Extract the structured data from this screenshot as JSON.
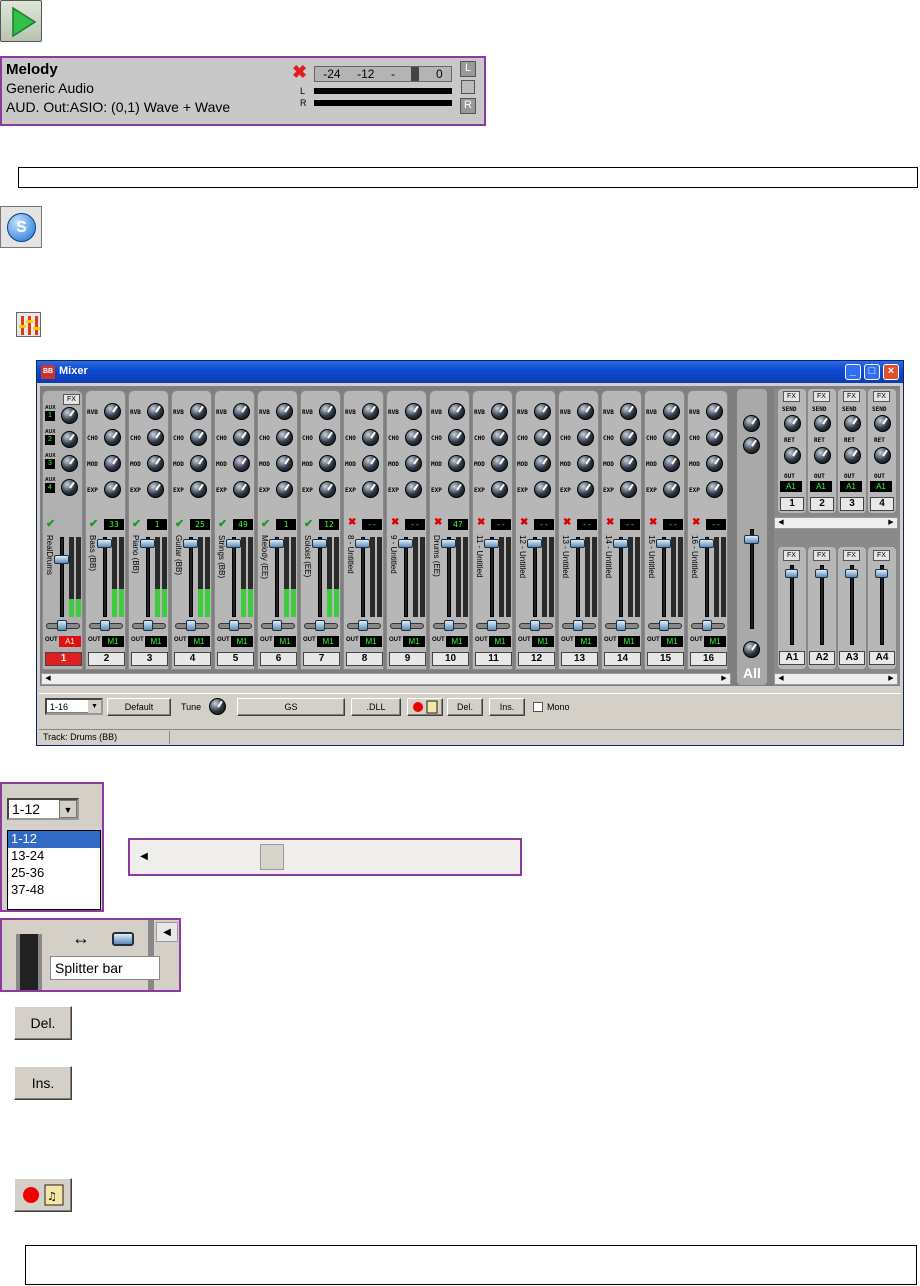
{
  "transport": {
    "play_icon": "play-icon"
  },
  "track_header": {
    "name": "Melody",
    "device": "Generic Audio",
    "output": "AUD. Out:ASIO: (0,1) Wave + Wave",
    "meter_scale": [
      "-24",
      "-12",
      "-",
      "0"
    ],
    "left_label": "L",
    "right_label": "R",
    "l_button": "L",
    "r_button": "R"
  },
  "solo_icon": "solo-icon",
  "mixer_icon": "mixer-icon",
  "mixer": {
    "title": "Mixer",
    "knob_labels": [
      "RVB",
      "CHO",
      "MOD",
      "EXP"
    ],
    "fx_label": "FX",
    "out_label": "OUT",
    "aux_labels": [
      "AUX",
      "AUX",
      "AUX",
      "AUX"
    ],
    "aux_values": [
      "1",
      "2",
      "3",
      "4"
    ],
    "strips": [
      {
        "name": "RealDrums",
        "vol": "",
        "num": "1",
        "out": "A1",
        "on": true,
        "active": true
      },
      {
        "name": "Bass  (BB)",
        "vol": "33",
        "num": "2",
        "out": "M1",
        "on": true
      },
      {
        "name": "Piano  (BB)",
        "vol": "1",
        "num": "3",
        "out": "M1",
        "on": true
      },
      {
        "name": "Guitar (BB)",
        "vol": "25",
        "num": "4",
        "out": "M1",
        "on": true
      },
      {
        "name": "Strings (BB)",
        "vol": "49",
        "num": "5",
        "out": "M1",
        "on": true
      },
      {
        "name": "Melody  (EE)",
        "vol": "1",
        "num": "6",
        "out": "M1",
        "on": true
      },
      {
        "name": "Soloist (EE)",
        "vol": "12",
        "num": "7",
        "out": "M1",
        "on": true
      },
      {
        "name": "8 - Untitled",
        "vol": "--",
        "num": "8",
        "out": "M1",
        "on": false
      },
      {
        "name": "9 - Untitled",
        "vol": "--",
        "num": "9",
        "out": "M1",
        "on": false
      },
      {
        "name": "Drums  (EE)",
        "vol": "47",
        "num": "10",
        "out": "M1",
        "on": false
      },
      {
        "name": "11 - Untitled",
        "vol": "--",
        "num": "11",
        "out": "M1",
        "on": false
      },
      {
        "name": "12 - Untitled",
        "vol": "--",
        "num": "12",
        "out": "M1",
        "on": false
      },
      {
        "name": "13 - Untitled",
        "vol": "--",
        "num": "13",
        "out": "M1",
        "on": false
      },
      {
        "name": "14 - Untitled",
        "vol": "--",
        "num": "14",
        "out": "M1",
        "on": false
      },
      {
        "name": "15 - Untitled",
        "vol": "--",
        "num": "15",
        "out": "M1",
        "on": false
      },
      {
        "name": "16 - Untitled",
        "vol": "--",
        "num": "16",
        "out": "M1",
        "on": false
      }
    ],
    "all_label": "All",
    "fx_sends": [
      {
        "out": "A1",
        "num": "1"
      },
      {
        "out": "A1",
        "num": "2"
      },
      {
        "out": "A1",
        "num": "3"
      },
      {
        "out": "A1",
        "num": "4"
      }
    ],
    "send_label": "SEND",
    "ret_label": "RET",
    "aux_busses": [
      "A1",
      "A2",
      "A3",
      "A4"
    ],
    "toolbar": {
      "range": "1-16",
      "default": "Default",
      "tune": "Tune",
      "gs": "GS",
      "dll": ".DLL",
      "del": "Del.",
      "ins": "Ins.",
      "mono": "Mono"
    },
    "status": "Track: Drums  (BB)"
  },
  "range_dropdown": {
    "selected": "1-12",
    "options": [
      "1-12",
      "13-24",
      "25-36",
      "37-48"
    ]
  },
  "scroll_example": {
    "position": 0.36
  },
  "splitter": {
    "tooltip": "Splitter bar"
  },
  "del_button": "Del.",
  "ins_button": "Ins.",
  "record_button": "record-audio-icon"
}
